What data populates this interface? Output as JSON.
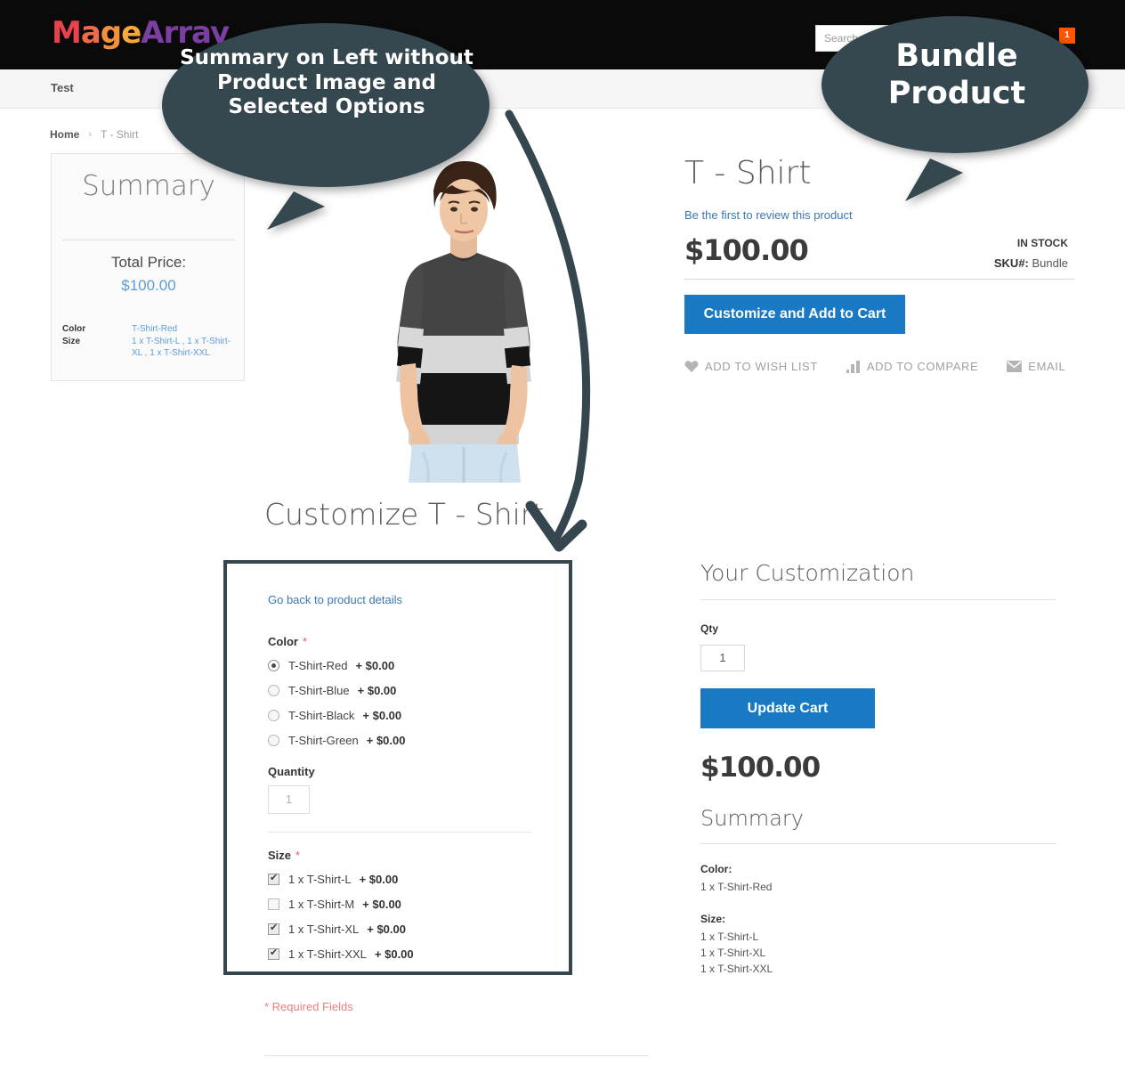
{
  "colors": {
    "accent_blue": "#1979c3",
    "link_blue": "#3b77b5",
    "summary_blue": "#5b9dd9",
    "badge_orange": "#ff5501",
    "annotation_slate": "#35464f",
    "required_red": "#e8807e",
    "header_black": "#0a0a0a",
    "nav_gray": "#f5f5f5"
  },
  "header": {
    "logo_parts": {
      "p1": "M",
      "p2": "a",
      "p3": "g",
      "p4": "e",
      "p5": "Array"
    },
    "search": {
      "placeholder": "Search...",
      "value": ""
    },
    "cart_count": "1"
  },
  "nav": {
    "items": [
      {
        "label": "Test"
      }
    ]
  },
  "breadcrumb": {
    "home": "Home",
    "separator": "›",
    "current": "T - Shirt"
  },
  "left_summary": {
    "title": "Summary",
    "total_price_label": "Total Price:",
    "total_price_value": "$100.00",
    "rows": [
      {
        "key": "Color",
        "value": "T-Shirt-Red"
      },
      {
        "key": "Size",
        "value": "1 x T-Shirt-L  , 1 x T-Shirt-XL  , 1 x T-Shirt-XXL"
      }
    ]
  },
  "product": {
    "title": "T - Shirt",
    "review_link": "Be the first to review this product",
    "price": "$100.00",
    "stock_status": "IN STOCK",
    "sku_label": "SKU#:",
    "sku_value": "Bundle",
    "add_to_cart_label": "Customize and Add to Cart",
    "links": [
      {
        "icon": "heart-icon",
        "label": "ADD TO WISH LIST"
      },
      {
        "icon": "compare-bars-icon",
        "label": "ADD TO COMPARE"
      },
      {
        "icon": "envelope-icon",
        "label": "EMAIL"
      }
    ],
    "image_alt": "male-model-colorblock-tshirt"
  },
  "customize": {
    "heading": "Customize T - Shirt",
    "go_back_link": "Go back to product details",
    "required_note": "* Required Fields",
    "groups": [
      {
        "label": "Color",
        "required_marker": "*",
        "type": "radio",
        "options": [
          {
            "name": "T-Shirt-Red",
            "price": "+ $0.00",
            "selected": true
          },
          {
            "name": "T-Shirt-Blue",
            "price": "+ $0.00",
            "selected": false
          },
          {
            "name": "T-Shirt-Black",
            "price": "+ $0.00",
            "selected": false
          },
          {
            "name": "T-Shirt-Green",
            "price": "+ $0.00",
            "selected": false
          }
        ]
      },
      {
        "label": "Size",
        "required_marker": "*",
        "type": "checkbox",
        "options": [
          {
            "name": "1 x T-Shirt-L",
            "price": "+ $0.00",
            "selected": true
          },
          {
            "name": "1 x T-Shirt-M",
            "price": "+ $0.00",
            "selected": false
          },
          {
            "name": "1 x T-Shirt-XL",
            "price": "+ $0.00",
            "selected": true
          },
          {
            "name": "1 x T-Shirt-XXL",
            "price": "+ $0.00",
            "selected": true
          }
        ]
      }
    ],
    "quantity_label": "Quantity",
    "quantity_value": "1"
  },
  "your_customization": {
    "heading": "Your Customization",
    "qty_label": "Qty",
    "qty_value": "1",
    "update_cart_label": "Update Cart",
    "price": "$100.00",
    "summary_heading": "Summary",
    "summary_blocks": [
      {
        "key": "Color:",
        "values": [
          "1 x T-Shirt-Red"
        ]
      },
      {
        "key": "Size:",
        "values": [
          "1 x T-Shirt-L",
          "1 x T-Shirt-XL",
          "1 x T-Shirt-XXL"
        ]
      }
    ]
  },
  "annotations": {
    "bubble_left": "Summary on Left without Product Image and Selected Options",
    "bubble_right": "Bundle Product"
  }
}
